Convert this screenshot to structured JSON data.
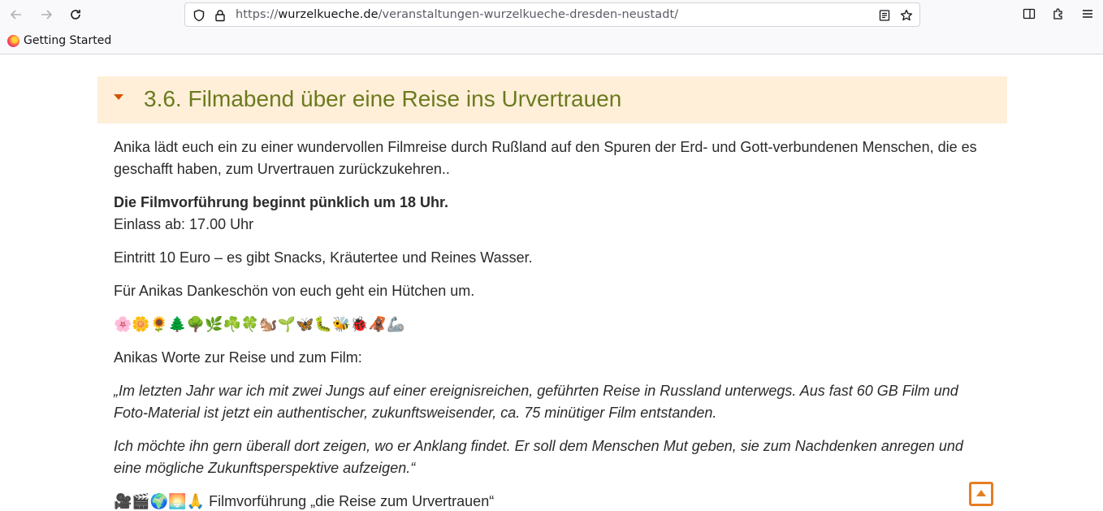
{
  "browser": {
    "url_prefix": "https://",
    "url_domain": "wurzelkueche.de",
    "url_path": "/veranstaltungen-wurzelkueche-dresden-neustadt/",
    "bookmarks": [
      {
        "label": "Getting Started"
      }
    ]
  },
  "section": {
    "title": "3.6. Filmabend über eine Reise ins Urvertrauen",
    "paragraphs": {
      "intro": "Anika lädt euch ein zu einer wundervollen Filmreise durch Rußland auf den Spuren der Erd- und Gott-verbundenen Menschen, die es geschafft haben, zum Urvertrauen zurückzukehren..",
      "start_bold": "Die Filmvorführung beginnt pünklich um 18 Uhr.",
      "entry": "Einlass ab: 17.00 Uhr",
      "price": "Eintritt 10 Euro – es gibt Snacks, Kräutertee und Reines Wasser.",
      "hat": "Für Anikas Dankeschön von euch geht ein Hütchen um.",
      "emojis": "🌸🌼🌻🌲🌳🌿☘️🍀🐿️🌱🦋🐛🐝🐞🦧🦾",
      "words_intro": "Anikas Worte zur Reise und zum Film:",
      "quote1": "„Im letzten Jahr war ich mit zwei Jungs auf einer ereignisreichen, geführten Reise in Russland unterwegs. Aus fast 60 GB Film und Foto-Material ist jetzt ein authentischer, zukunftsweisender, ca. 75 minütiger Film entstanden.",
      "quote2": "Ich möchte ihn gern überall dort zeigen, wo er Anklang findet. Er soll dem Menschen Mut geben, sie zum Nachdenken anregen und eine mögliche Zukunftsperspektive aufzeigen.“",
      "screening_emojis": "🎥🎬🌍🌅🙏",
      "screening": "Filmvorführung „die Reise zum Urvertrauen“"
    }
  },
  "colors": {
    "accent": "#e67e22",
    "title": "#6b7a1e",
    "header_bg": "#ffefd9"
  }
}
